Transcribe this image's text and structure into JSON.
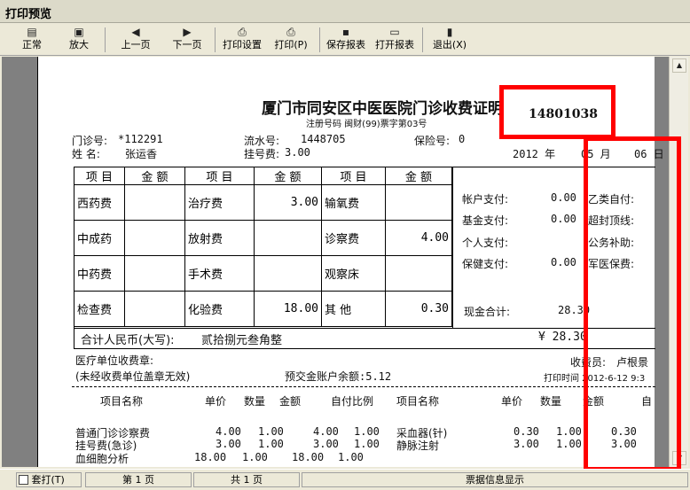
{
  "window": {
    "title": "打印预览"
  },
  "toolbar": {
    "normal": "正常",
    "zoom": "放大",
    "prev_page": "上一页",
    "next_page": "下一页",
    "print_setup": "打印设置",
    "print": "打印(P)",
    "save_report": "保存报表",
    "open_report": "打开报表",
    "exit": "退出(X)"
  },
  "receipt": {
    "title": "厦门市同安区中医医院门诊收费证明",
    "reg_no": "注册号码 闽财(99)票字第03号",
    "stamp_number": "14801038",
    "clinic_no_label": "门诊号:",
    "clinic_no": "*112291",
    "serial_label": "流水号:",
    "serial": "1448705",
    "insurance_label": "保险号:",
    "insurance": "0",
    "name_label": "姓  名:",
    "name": "张运香",
    "reg_fee_label": "挂号费:",
    "reg_fee": "3.00",
    "year": "2012 年",
    "month": "05 月",
    "day": "06 日",
    "col_headers": [
      "项 目",
      "金 额",
      "项 目",
      "金 额",
      "项 目",
      "金 额"
    ],
    "rows": [
      [
        "西药费",
        "",
        "治疗费",
        "3.00",
        "输氧费",
        ""
      ],
      [
        "中成药",
        "",
        "放射费",
        "",
        "诊察费",
        "4.00"
      ],
      [
        "中药费",
        "",
        "手术费",
        "",
        "观察床",
        ""
      ],
      [
        "检查费",
        "",
        "化验费",
        "18.00",
        "其  他",
        "0.30"
      ]
    ],
    "payments": [
      {
        "label": "帐户支付:",
        "value": "0.00",
        "label2": "乙类自付:"
      },
      {
        "label": "基金支付:",
        "value": "0.00",
        "label2": "超封顶线:"
      },
      {
        "label": "个人支付:",
        "value": "",
        "label2": "公务补助:"
      },
      {
        "label": "保健支付:",
        "value": "0.00",
        "label2": "军医保费:"
      }
    ],
    "cash_total_label": "现金合计:",
    "cash_total": "28.30",
    "total_rmb_label": "合计人民币(大写):",
    "total_rmb_words": "贰拾捌元叁角整",
    "total_rmb_amount": "¥ 28.30",
    "unit_stamp": "医疗单位收费章:",
    "invalid_note": "(未经收费单位盖章无效)",
    "prepay_balance": "预交金账户余额:5.12",
    "cashier_label": "收费员:",
    "cashier": "卢根景",
    "print_time": "打印时间 2012-6-12 9:3",
    "detail_headers": [
      "项目名称",
      "单价",
      "数量",
      "金额",
      "自付比例",
      "项目名称",
      "单价",
      "数量",
      "金额",
      "自"
    ],
    "details_left": [
      {
        "name": "普通门诊诊察费",
        "price": "4.00",
        "qty": "1.00",
        "amount": "4.00",
        "ratio": "1.00"
      },
      {
        "name": "挂号费(急诊)",
        "price": "3.00",
        "qty": "1.00",
        "amount": "3.00",
        "ratio": "1.00"
      },
      {
        "name": "血细胞分析",
        "price": "18.00",
        "qty": "1.00",
        "amount": "18.00",
        "ratio": "1.00"
      }
    ],
    "details_right": [
      {
        "name": "采血器(针)",
        "price": "0.30",
        "qty": "1.00",
        "amount": "0.30"
      },
      {
        "name": "静脉注射",
        "price": "3.00",
        "qty": "1.00",
        "amount": "3.00"
      }
    ]
  },
  "status": {
    "checkbox_label": "套打(T)",
    "page": "第 1 页",
    "total": "共 1 页",
    "info": "票据信息显示"
  },
  "colors": {
    "highlight": "#ff0000"
  }
}
